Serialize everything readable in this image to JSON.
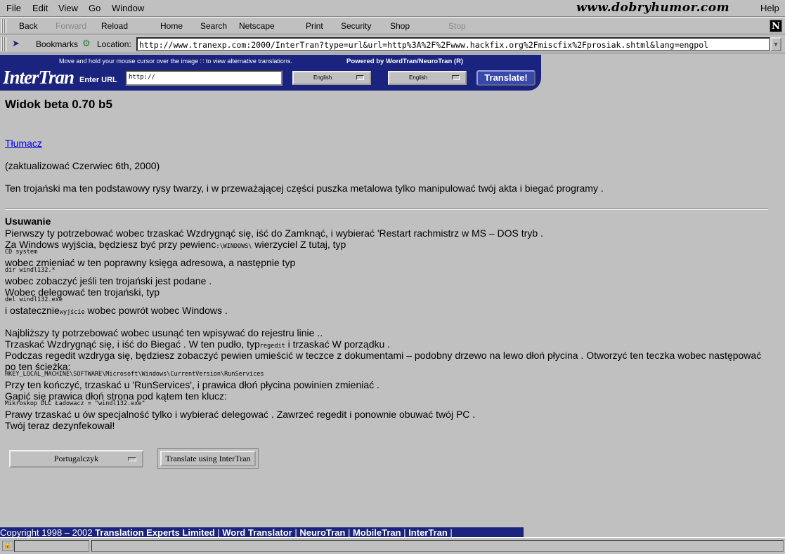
{
  "menu": [
    "File",
    "Edit",
    "View",
    "Go",
    "Window"
  ],
  "menu_help": "Help",
  "watermark": "www.dobryhumor.com",
  "toolbar": {
    "back": "Back",
    "forward": "Forward",
    "reload": "Reload",
    "home": "Home",
    "search": "Search",
    "netscape": "Netscape",
    "print": "Print",
    "security": "Security",
    "shop": "Shop",
    "stop": "Stop"
  },
  "location": {
    "bookmarks": "Bookmarks",
    "label": "Location:",
    "url": "http://www.tranexp.com:2000/InterTran?type=url&url=http%3A%2F%2Fwww.hackfix.org%2Fmiscfix%2Fprosiak.shtml&lang=engpol"
  },
  "intertran": {
    "hint": "Move and hold your mouse cursor over the image ∷ to view alternative translations.",
    "powered": "Powered by WordTran/NeuroTran (R)",
    "logo": "InterTran",
    "enter_url": "Enter URL",
    "url_value": "http://",
    "from_lang": "English",
    "to_lang": "English",
    "translate_button": "Translate!"
  },
  "page": {
    "title": "Widok beta 0.70 b5",
    "link": "Tłumacz ",
    "updated": "(zaktualizować Czerwiec 6th, 2000)",
    "intro": "Ten trojański ma ten podstawowy rysy twarzy, i w przeważającej części puszka metalowa tylko manipulować twój akta i biegać programy .",
    "removal_heading": "Usuwanie",
    "l1": "Pierwszy ty potrzebować wobec trzaskać Wzdrygnąć się, iść do Zamknąć, i wybierać 'Restart rachmistrz w MS – DOS tryb .",
    "l2a": "Za Windows wyjścia, będziesz być przy pewienc",
    "l2code": ":\\WINDOWS\\",
    "l2b": " wierzyciel Z tutaj, typ",
    "code1": "CD system",
    "l3": "wobec zmieniać w ten poprawny księga adresowa, a następnie typ",
    "code2": "dir windl132.*",
    "l4": "wobec zobaczyć jeśli ten trojański jest podane .",
    "l5": "Wobec delegować ten trojański, typ",
    "code3": "del windl132.exe",
    "l6a": "i ostatecznie",
    "l6code": "wyjście",
    "l6b": " wobec powrót wobec Windows .",
    "l7": "Najbliższy ty potrzebować wobec usunąć ten wpisywać do rejestru linie ..",
    "l8a": "Trzaskać Wzdrygnąć się, i iść do Biegać . W ten pudło, typ",
    "l8code": "regedit",
    "l8b": " i trzaskać W porządku .",
    "l9": "Podczas regedit wzdryga się, będziesz zobaczyć pewien umieścić w teczce z dokumentami – podobny drzewo na lewo dłoń płycina . Otworzyć ten teczka wobec następować",
    "l10": "po ten ścieżka:",
    "code4": "HKEY_LOCAL_MACHINE\\SOFTWARE\\Microsoft\\Windows\\CurrentVersion\\RunServices",
    "l11": "Przy ten kończyć, trzaskać u 'RunServices', i prawica dłoń płycina powinien zmieniać .",
    "l12": "Gapić się prawica dłoń strona pod kątem ten klucz:",
    "code5": "Mikroskop DLL Ładowacz = \"windl132.exe\"",
    "l13": "Prawy trzaskać u ów specjalność tylko i wybierać delegować . Zawrzeć regedit i ponownie obuwać twój PC .",
    "l14": "Twój teraz dezynfekował!"
  },
  "form": {
    "language": "Portugalczyk",
    "translate_button": "Translate using InterTran"
  },
  "footer": {
    "copyright": "Copyright 1998 – 2002 ",
    "company": "Translation Experts Limited",
    "sep": " | ",
    "links": [
      "Word Translator",
      "NeuroTran",
      "MobileTran",
      "InterTran"
    ]
  }
}
